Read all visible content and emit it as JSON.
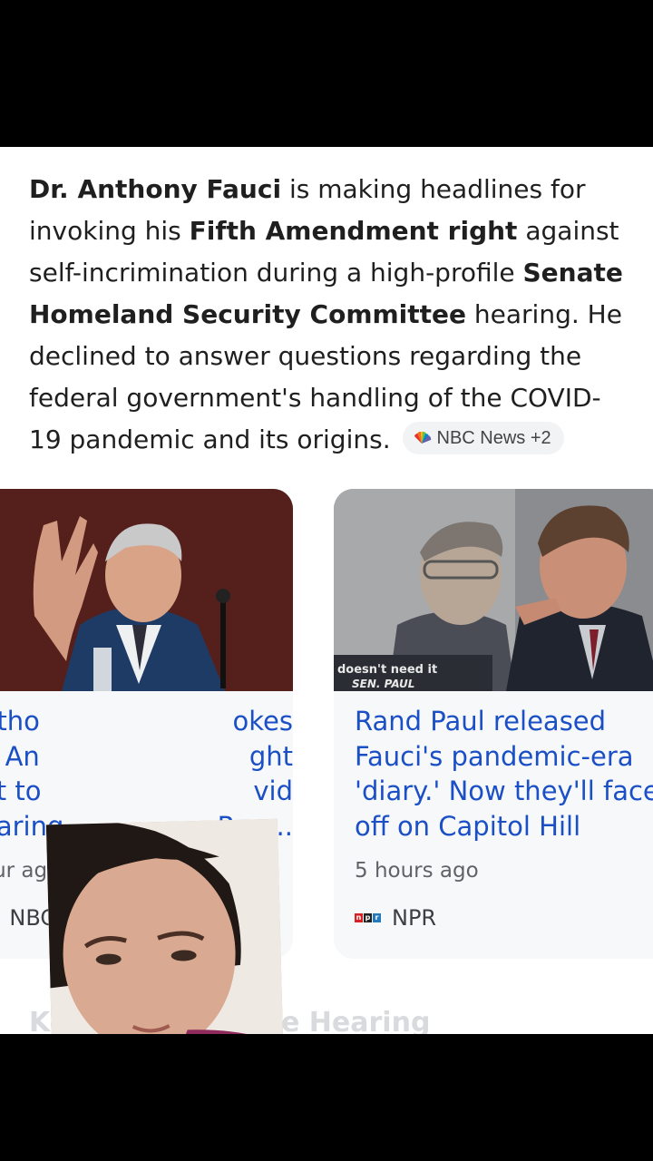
{
  "summary": {
    "b1": "Dr. Anthony Fauci",
    "t1": " is making headlines for invoking his ",
    "b2": "Fifth Amendment right",
    "t2": " against self-incrimination during a high-profile ",
    "b3": "Senate Homeland Security Committee",
    "t3": " hearing. He declined to answer questions regarding the federal government's handling of the COVID-19 pandemic and its origins.",
    "source_chip": "NBC News +2"
  },
  "cards": [
    {
      "headline": "Anthony Fauci invokes Fifth Amendment right not to testify at Covid hearing called by Ran...",
      "visible_lines": [
        "ntho",
        "okes",
        "h An",
        "ght",
        "ot to",
        "vid",
        "earing",
        "Ran..."
      ],
      "time": "our ago",
      "source": "NBC"
    },
    {
      "headline": "Rand Paul released Fauci's pandemic-era 'diary.' Now they'll face off on Capitol Hill",
      "image_caption": "doesn't need it",
      "image_nameplate": "SEN. PAUL",
      "time": "5 hours ago",
      "source": "NPR"
    }
  ],
  "next_section": "Key ... During the Hearing",
  "colors": {
    "headline": "#1a4fc6",
    "text": "#1f1f1f",
    "meta": "#5f6368",
    "card_bg": "#f7f8fa"
  },
  "icons": {
    "nbc": "nbc-peacock-icon",
    "npr": "npr-logo-icon",
    "menu": "more-vert-icon"
  }
}
